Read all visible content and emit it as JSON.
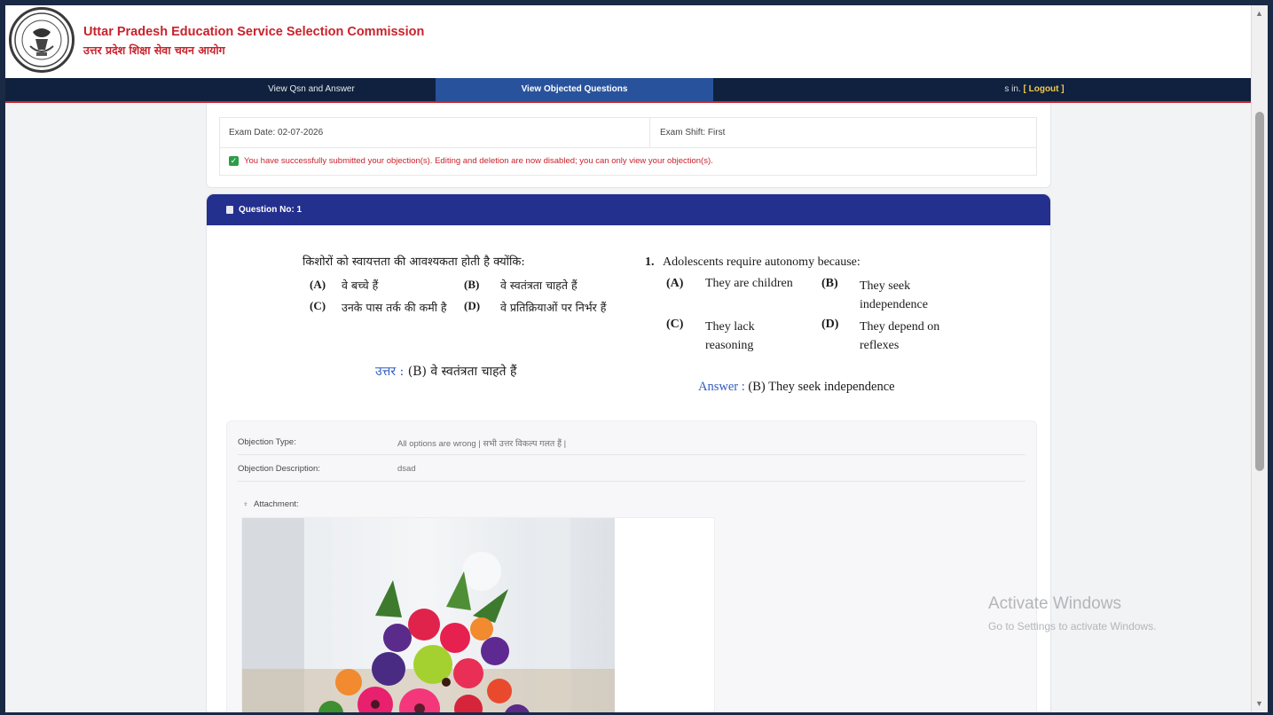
{
  "header": {
    "org_name_en": "Uttar Pradesh Education Service Selection Commission",
    "org_name_hi": "उत्तर प्रदेश शिक्षा सेवा चयन आयोग"
  },
  "nav": {
    "view_qsn": "View Qsn and Answer",
    "view_objected": "View Objected Questions",
    "user_prefix": "s in. ",
    "logout": "[ Logout ]"
  },
  "exam": {
    "date": "Exam Date: 02-07-2026",
    "shift": "Exam Shift: First",
    "success_msg": "You have successfully submitted your objection(s). Editing and deletion are now disabled; you can only view your objection(s)."
  },
  "question": {
    "header": "Question No: 1",
    "hi": {
      "text": "किशोरों को स्वायत्तता की आवश्यकता होती है क्योंकि:",
      "options": [
        {
          "key": "(A)",
          "text": "वे बच्चे हैं"
        },
        {
          "key": "(B)",
          "text": "वे स्वतंत्रता चाहते हैं"
        },
        {
          "key": "(C)",
          "text": "उनके पास तर्क की कमी है"
        },
        {
          "key": "(D)",
          "text": "वे प्रतिक्रियाओं पर निर्भर हैं"
        }
      ],
      "answer_label": "उत्तर :",
      "answer_value": " (B) वे स्वतंत्रता चाहते हैं"
    },
    "en": {
      "number": "1.",
      "text": "Adolescents require autonomy because:",
      "options": [
        {
          "key": "(A)",
          "text": "They are children"
        },
        {
          "key": "(B)",
          "text": "They seek independence"
        },
        {
          "key": "(C)",
          "text": "They lack reasoning"
        },
        {
          "key": "(D)",
          "text": "They depend on reflexes"
        }
      ],
      "answer_label": "Answer :",
      "answer_value": " (B) They seek independence"
    }
  },
  "objection": {
    "type_label": "Objection Type:",
    "type_value": "All options are wrong | सभी उत्तर विकल्प गलत हैं |",
    "desc_label": "Objection Description:",
    "desc_value": "dsad",
    "attach_label": "Attachment:"
  },
  "watermark": {
    "title": "Activate Windows",
    "subtitle": "Go to Settings to activate Windows."
  }
}
